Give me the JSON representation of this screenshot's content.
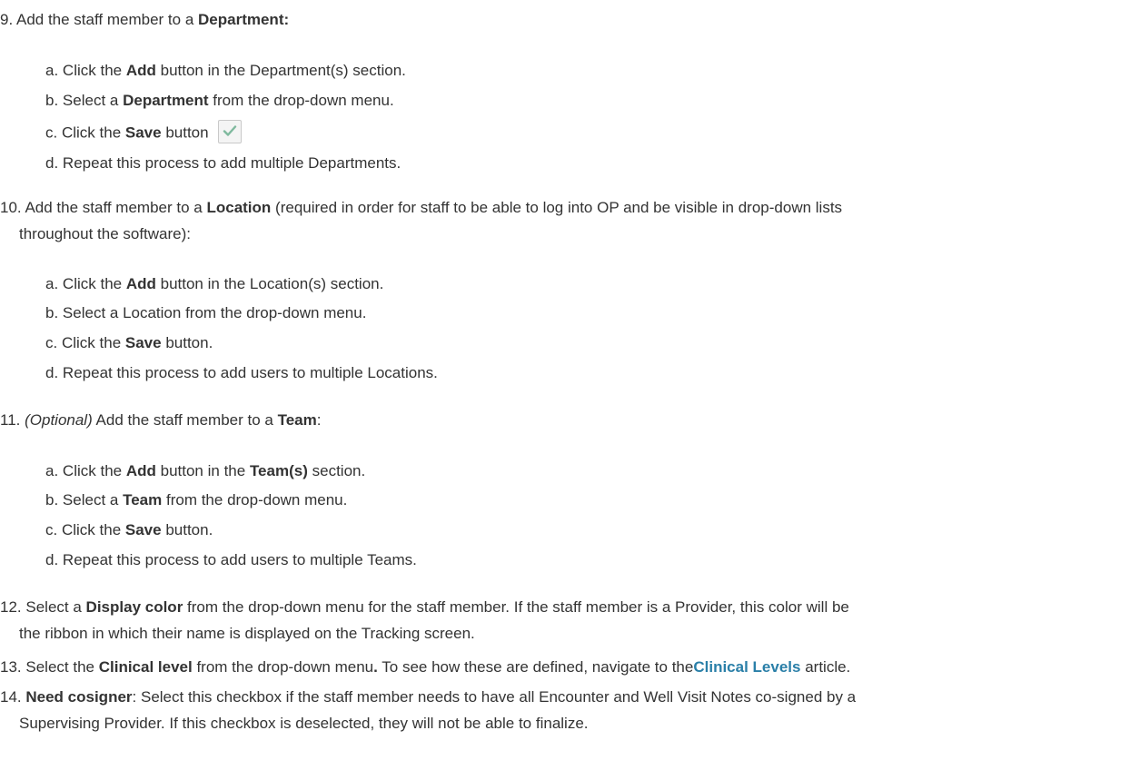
{
  "step9": {
    "num": "9.",
    "text": "Add the staff member to a",
    "bold": "Department:",
    "subs": [
      {
        "letter": "a.",
        "pre": "Click the",
        "bold": "Add",
        "post": "button in the Department(s) section."
      },
      {
        "letter": "b.",
        "pre": "Select a",
        "bold": "Department",
        "post": "from the drop-down menu."
      },
      {
        "letter": "c.",
        "pre": "Click the",
        "bold": "Save",
        "post": "button"
      },
      {
        "letter": "d.",
        "text": "Repeat this process to add multiple Departments."
      }
    ],
    "save_icon": "checkmark-icon"
  },
  "step10": {
    "num": "10.",
    "text": "Add the staff member to a",
    "bold": "Location",
    "post": "(required in order for staff to be able to log into OP and be visible in drop-down lists",
    "cont": "throughout the software):",
    "subs": [
      {
        "letter": "a.",
        "pre": "Click the",
        "bold": "Add",
        "post": "button in the Location(s) section."
      },
      {
        "letter": "b.",
        "text": "Select a Location from the drop-down menu."
      },
      {
        "letter": "c.",
        "pre": "Click the",
        "bold": "Save",
        "post": "button."
      },
      {
        "letter": "d.",
        "text": "Repeat this process to add users to multiple Locations."
      }
    ]
  },
  "step11": {
    "num": "11.",
    "italic": "(Optional)",
    "text": "Add the staff member to a",
    "bold": "Team",
    "post": ":",
    "subs": [
      {
        "letter": "a.",
        "pre": "Click the",
        "bold": "Add",
        "mid": "button in the",
        "bold2": "Team(s)",
        "post": "section."
      },
      {
        "letter": "b.",
        "pre": "Select a",
        "bold": "Team",
        "post": "from the drop-down menu."
      },
      {
        "letter": "c.",
        "pre": "Click the",
        "bold": "Save",
        "post": "button."
      },
      {
        "letter": "d.",
        "text": "Repeat this process to add users to multiple Teams."
      }
    ]
  },
  "step12": {
    "num": "12.",
    "pre": "Select a",
    "bold": "Display color",
    "post": "from the drop-down menu for the staff member. If the staff member is a Provider, this color will be",
    "cont": "the ribbon in which their name is displayed on the Tracking screen."
  },
  "step13": {
    "num": "13.",
    "pre": "Select the",
    "bold": "Clinical level",
    "post": "from the drop-down menu",
    "bold_dot": ".",
    "post2": "To see how these are defined, navigate to the",
    "link": "Clinical Levels",
    "post3": "article."
  },
  "step14": {
    "num": "14.",
    "bold": "Need cosigner",
    "post": ": Select this checkbox if the staff member needs to have all Encounter and Well Visit Notes co-signed by a",
    "cont": "Supervising Provider. If this checkbox is deselected, they will not be able to finalize."
  },
  "colors": {
    "text": "#333333",
    "link": "#2a7fa8",
    "check": "#7fb99e"
  }
}
